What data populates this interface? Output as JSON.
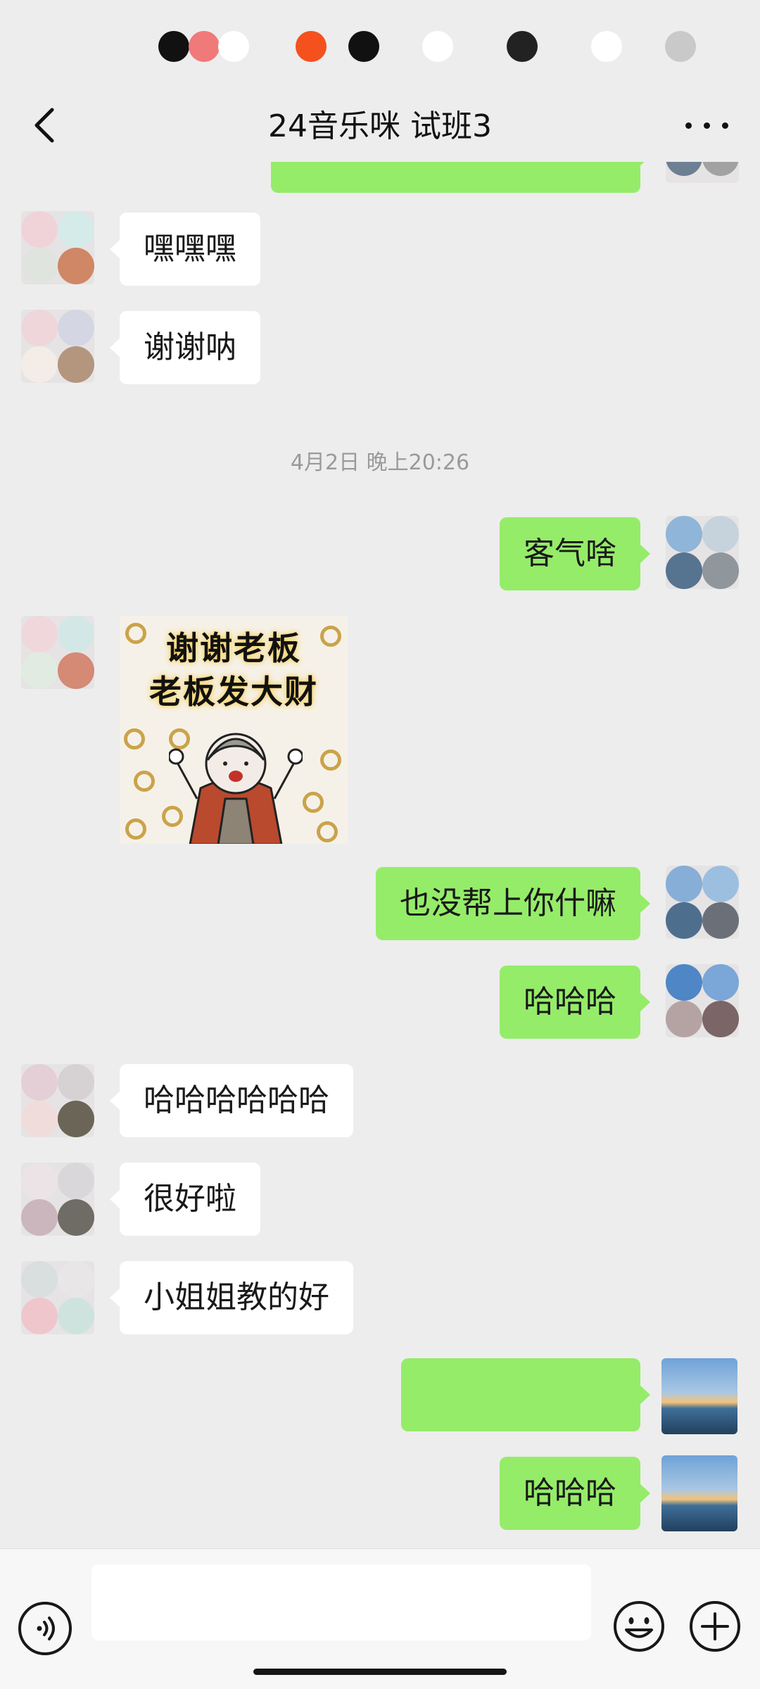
{
  "header": {
    "title": "24音乐咪   试班3",
    "back_icon": "chevron-left-icon",
    "more_icon": "more-dots-icon"
  },
  "timestamp": "4月2日 晚上20:26",
  "messages": [
    {
      "side": "in",
      "text": "嘿嘿嘿"
    },
    {
      "side": "in",
      "text": "谢谢呐"
    },
    {
      "side": "out",
      "text": "客气啥"
    },
    {
      "side": "in",
      "type": "sticker"
    },
    {
      "side": "out",
      "text": "也没帮上你什嘛"
    },
    {
      "side": "out",
      "text": "哈哈哈"
    },
    {
      "side": "in",
      "text": "哈哈哈哈哈哈"
    },
    {
      "side": "in",
      "text": "很好啦"
    },
    {
      "side": "in",
      "text": "小姐姐教的好"
    },
    {
      "side": "out",
      "text": ""
    },
    {
      "side": "out",
      "text": "哈哈哈"
    }
  ],
  "sticker": {
    "line1": "谢谢老板",
    "line2": "老板发大财"
  },
  "input_bar": {
    "voice_icon": "voice-icon",
    "emoji_icon": "emoji-icon",
    "plus_icon": "plus-icon",
    "text_value": ""
  },
  "colors": {
    "background": "#ededed",
    "outgoing_bubble": "#95ec69",
    "incoming_bubble": "#ffffff",
    "timestamp": "#9a9a9a"
  }
}
